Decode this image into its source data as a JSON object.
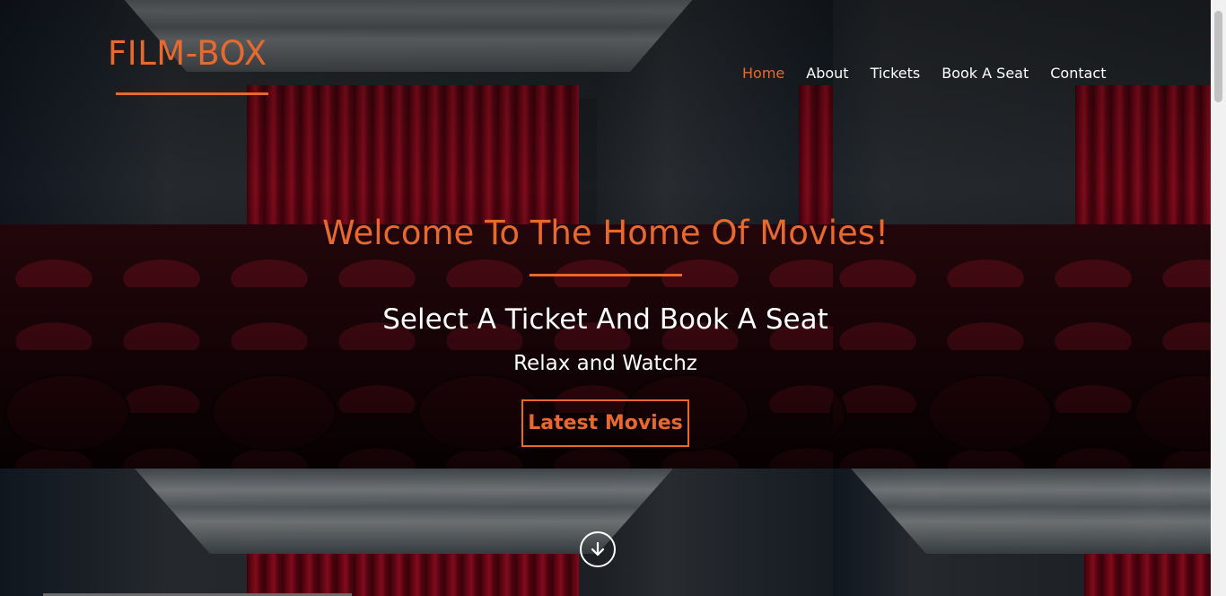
{
  "brand": {
    "name": "FILM-BOX",
    "accent_color": "#e8692e"
  },
  "nav": {
    "items": [
      {
        "label": "Home",
        "active": true
      },
      {
        "label": "About",
        "active": false
      },
      {
        "label": "Tickets",
        "active": false
      },
      {
        "label": "Book A Seat",
        "active": false
      },
      {
        "label": "Contact",
        "active": false
      }
    ]
  },
  "hero": {
    "title": "Welcome To The Home Of Movies!",
    "subtitle": "Select A Ticket And Book A Seat",
    "tagline": "Relax and Watchz",
    "cta_label": "Latest Movies",
    "background": "movie theater with red curtains and seats"
  },
  "scroll_down_icon": "arrow-down-circle-icon"
}
